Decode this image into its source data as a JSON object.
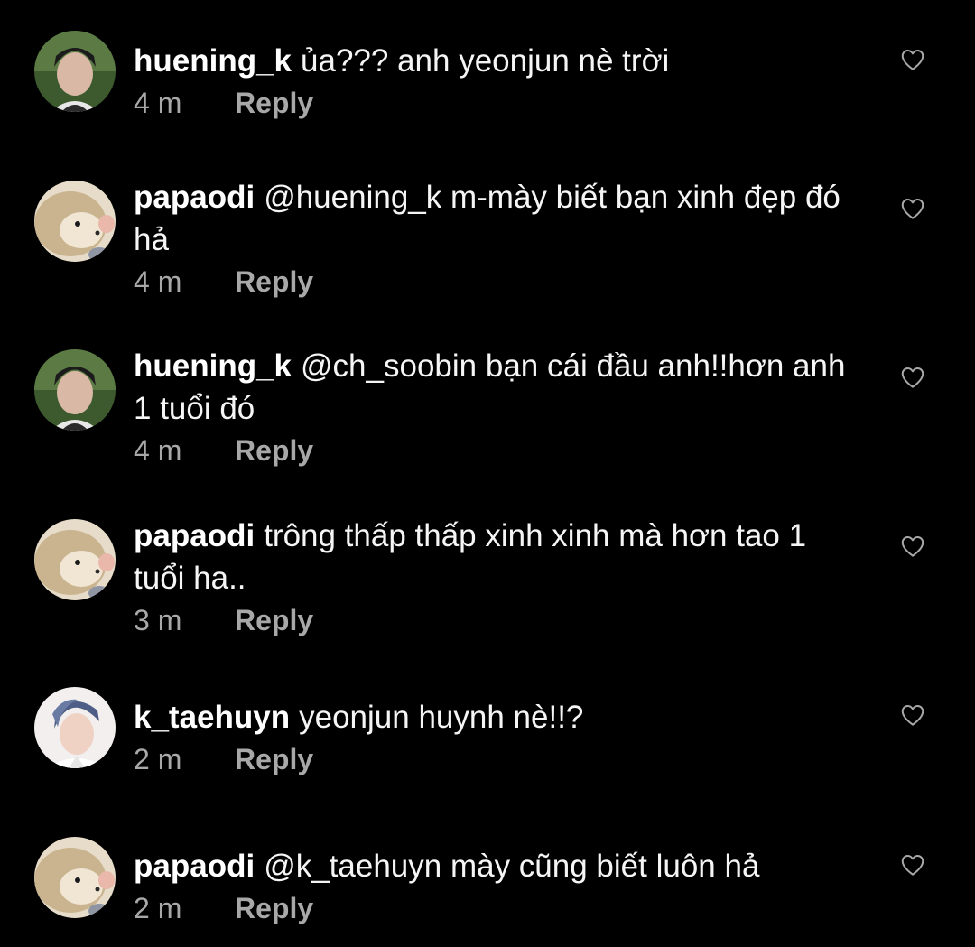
{
  "colors": {
    "background": "#000000",
    "text": "#f5f5f5",
    "muted": "#a8a8a8"
  },
  "comments": [
    {
      "username": "huening_k",
      "text": "ủa??? anh yeonjun nè trời",
      "time": "4 m",
      "reply_label": "Reply",
      "avatar": "huening-avatar",
      "like_icon": "heart-outline-icon"
    },
    {
      "username": "papaodi",
      "text": "@huening_k m-mày biết bạn xinh đẹp đó hả",
      "time": "4 m",
      "reply_label": "Reply",
      "avatar": "hedgehog-avatar",
      "like_icon": "heart-outline-icon"
    },
    {
      "username": "huening_k",
      "text": "@ch_soobin bạn cái đầu anh!!hơn anh 1 tuổi đó",
      "time": "4 m",
      "reply_label": "Reply",
      "avatar": "huening-avatar",
      "like_icon": "heart-outline-icon"
    },
    {
      "username": "papaodi",
      "text": "trông thấp thấp xinh xinh mà hơn tao 1 tuổi ha..",
      "time": "3 m",
      "reply_label": "Reply",
      "avatar": "hedgehog-avatar",
      "like_icon": "heart-outline-icon"
    },
    {
      "username": "k_taehuyn",
      "text": "yeonjun huynh nè!!?",
      "time": "2 m",
      "reply_label": "Reply",
      "avatar": "taehyun-avatar",
      "like_icon": "heart-outline-icon"
    },
    {
      "username": "papaodi",
      "text": "@k_taehuyn mày cũng biết luôn hả",
      "time": "2 m",
      "reply_label": "Reply",
      "avatar": "hedgehog-avatar",
      "like_icon": "heart-outline-icon"
    }
  ]
}
